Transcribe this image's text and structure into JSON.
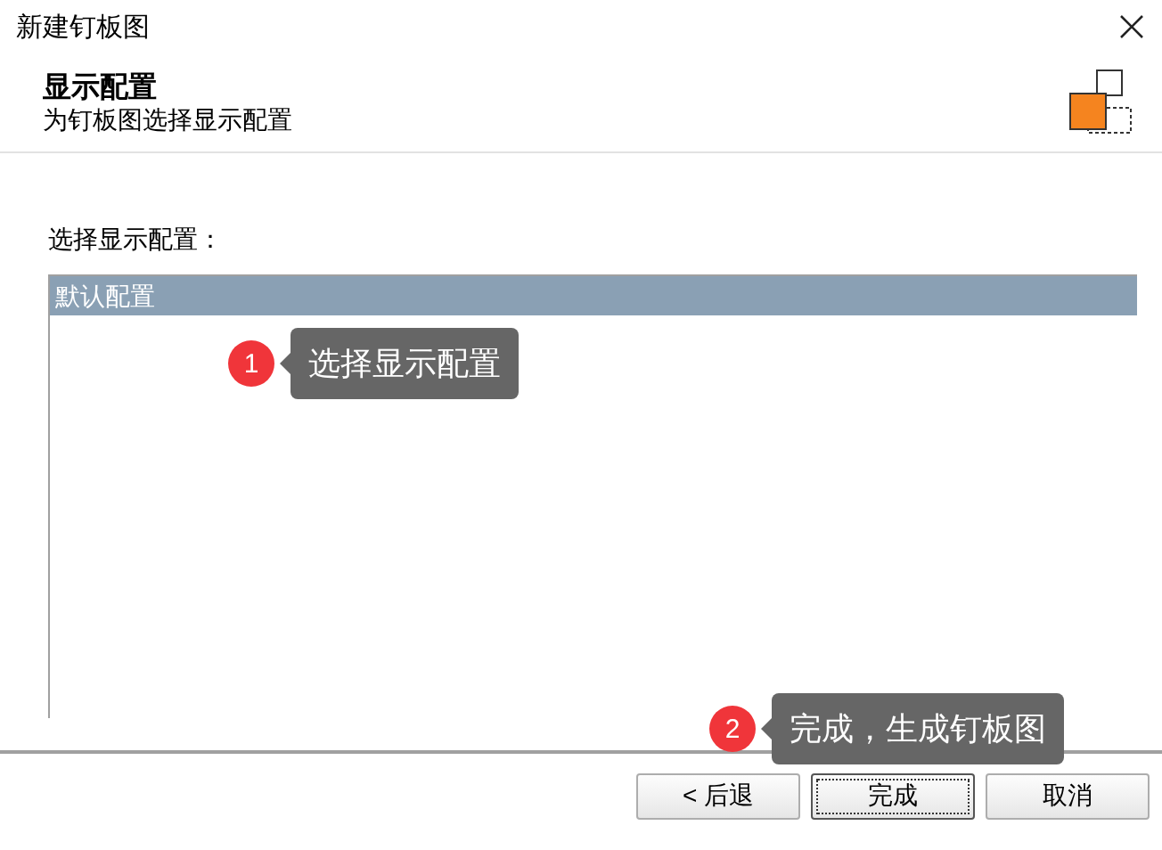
{
  "window": {
    "title": "新建钉板图"
  },
  "header": {
    "title": "显示配置",
    "subtitle": "为钉板图选择显示配置"
  },
  "config_list": {
    "label": "选择显示配置：",
    "items": [
      {
        "label": "默认配置",
        "selected": true
      }
    ]
  },
  "buttons": [
    {
      "label": "< 后退",
      "focused": false
    },
    {
      "label": "完成",
      "focused": true
    },
    {
      "label": "取消",
      "focused": false
    }
  ],
  "callouts": [
    {
      "number": "1",
      "text": "选择显示配置"
    },
    {
      "number": "2",
      "text": "完成，生成钉板图"
    }
  ]
}
